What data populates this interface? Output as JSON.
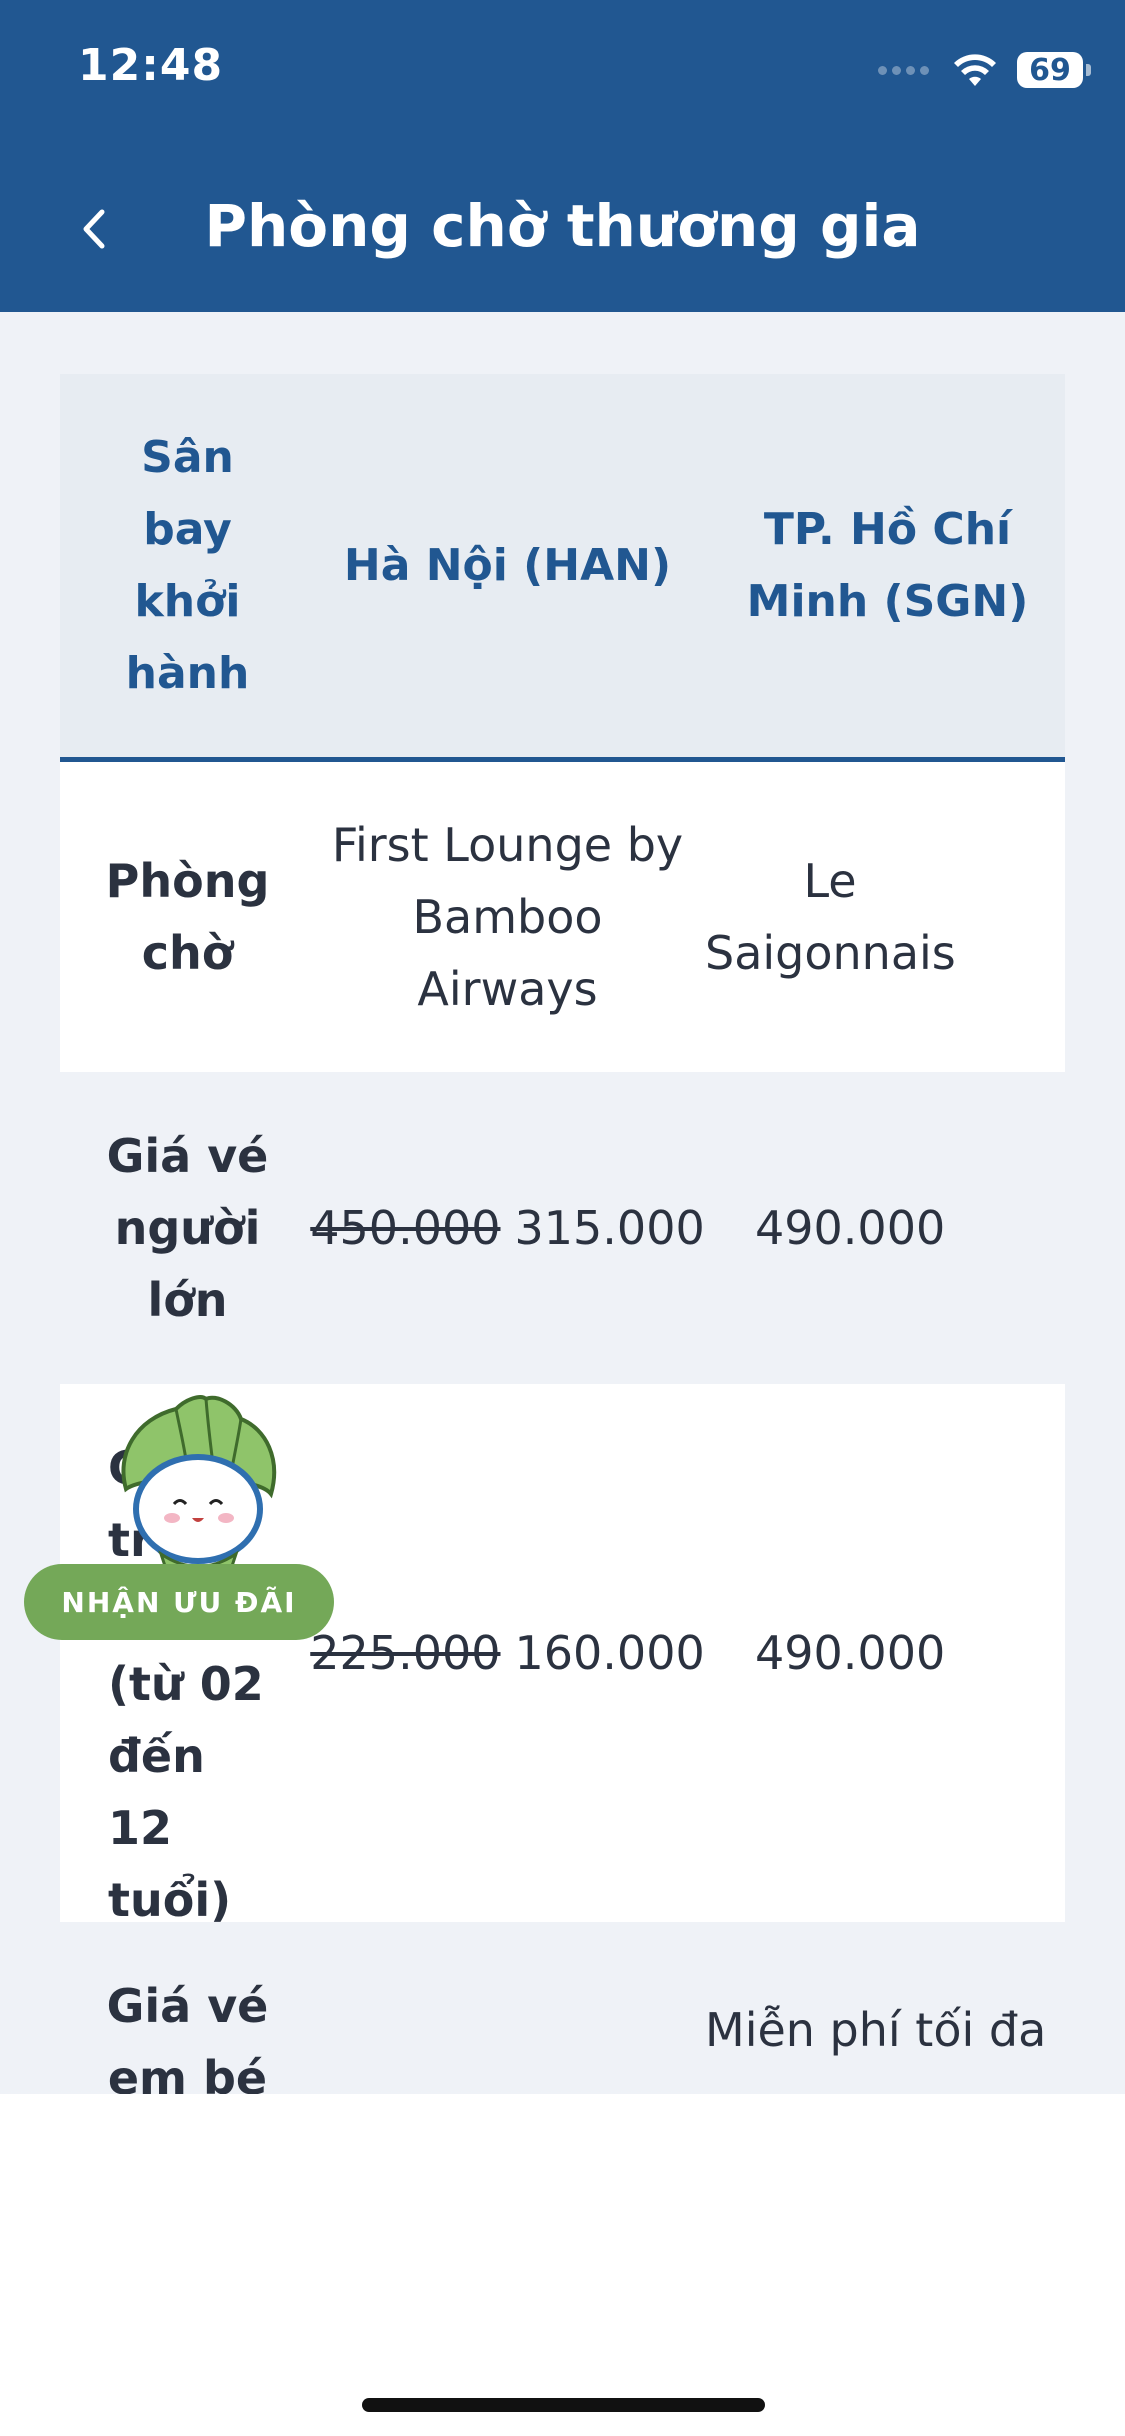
{
  "status_bar": {
    "time": "12:48",
    "battery": "69"
  },
  "header": {
    "title": "Phòng chờ thương gia"
  },
  "table": {
    "columns": [
      "Sân bay khởi hành",
      "Hà Nội (HAN)",
      "TP. Hồ Chí Minh (SGN)"
    ],
    "rows": [
      {
        "label": "Phòng chờ",
        "han": "First Lounge by Bamboo Airways",
        "sgn": "Le Saigonnais"
      },
      {
        "label": "Giá vé người lớn",
        "han_old": "450.000",
        "han_new": "315.000",
        "sgn": "490.000"
      },
      {
        "label": "Giá vé trẻ em (từ 02 đến 12 tuổi)",
        "han_old": "225.000",
        "han_new": "160.000",
        "sgn": "490.000"
      },
      {
        "label": "Giá vé em bé",
        "sgn": "Miễn phí tối đa"
      }
    ]
  },
  "promo": {
    "label": "NHẬN ƯU ĐÃI"
  },
  "colors": {
    "primary": "#215791",
    "promo_green": "#74a858",
    "background": "#eff2f7"
  },
  "icons": {
    "back": "chevron-left-icon",
    "wifi": "wifi-icon",
    "mascot": "mascot-icon"
  }
}
